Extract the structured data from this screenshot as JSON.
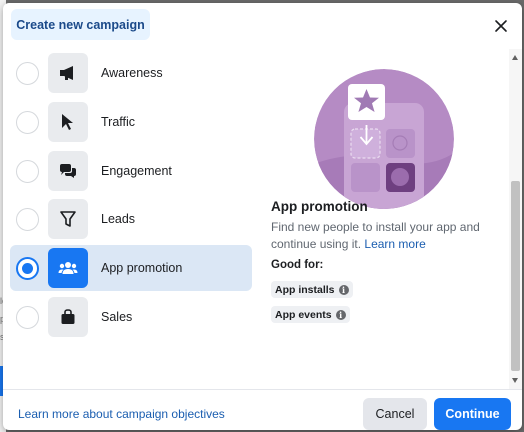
{
  "dialog": {
    "title": "Create new campaign"
  },
  "objectives": [
    {
      "label": "Awareness",
      "icon": "megaphone-icon",
      "selected": false
    },
    {
      "label": "Traffic",
      "icon": "cursor-icon",
      "selected": false
    },
    {
      "label": "Engagement",
      "icon": "chat-bubbles-icon",
      "selected": false
    },
    {
      "label": "Leads",
      "icon": "funnel-icon",
      "selected": false
    },
    {
      "label": "App promotion",
      "icon": "people-icon",
      "selected": true
    },
    {
      "label": "Sales",
      "icon": "shopping-bag-icon",
      "selected": false
    }
  ],
  "detail": {
    "title": "App promotion",
    "description": "Find new people to install your app and continue using it.",
    "learn_more": "Learn more",
    "good_for_label": "Good for:",
    "tags": [
      "App installs",
      "App events"
    ]
  },
  "footer": {
    "link": "Learn more about campaign objectives",
    "cancel": "Cancel",
    "continue": "Continue"
  },
  "colors": {
    "primary": "#1877f2",
    "selected_bg": "#dbe7f5",
    "illustration_purple": "#b58bc4"
  }
}
